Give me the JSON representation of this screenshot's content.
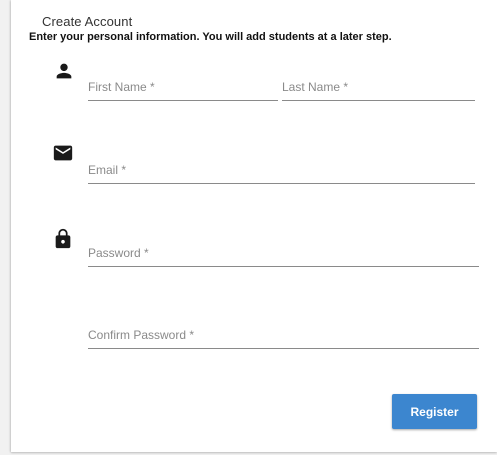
{
  "form": {
    "title": "Create Account",
    "subtitle": "Enter your personal information.  You will add students at a later step.",
    "fields": {
      "first_name": {
        "placeholder": "First Name *",
        "value": ""
      },
      "last_name": {
        "placeholder": "Last Name *",
        "value": ""
      },
      "email": {
        "placeholder": "Email *",
        "value": ""
      },
      "password": {
        "placeholder": "Password *",
        "value": ""
      },
      "confirm_password": {
        "placeholder": "Confirm Password *",
        "value": ""
      }
    },
    "register_label": "Register"
  },
  "icons": {
    "person": "person-icon",
    "mail": "mail-icon",
    "lock": "lock-icon"
  },
  "colors": {
    "accent": "#3c86cf",
    "icon": "#1a1a1a",
    "underline": "#8a8a8a",
    "placeholder": "#8a8a8a"
  }
}
